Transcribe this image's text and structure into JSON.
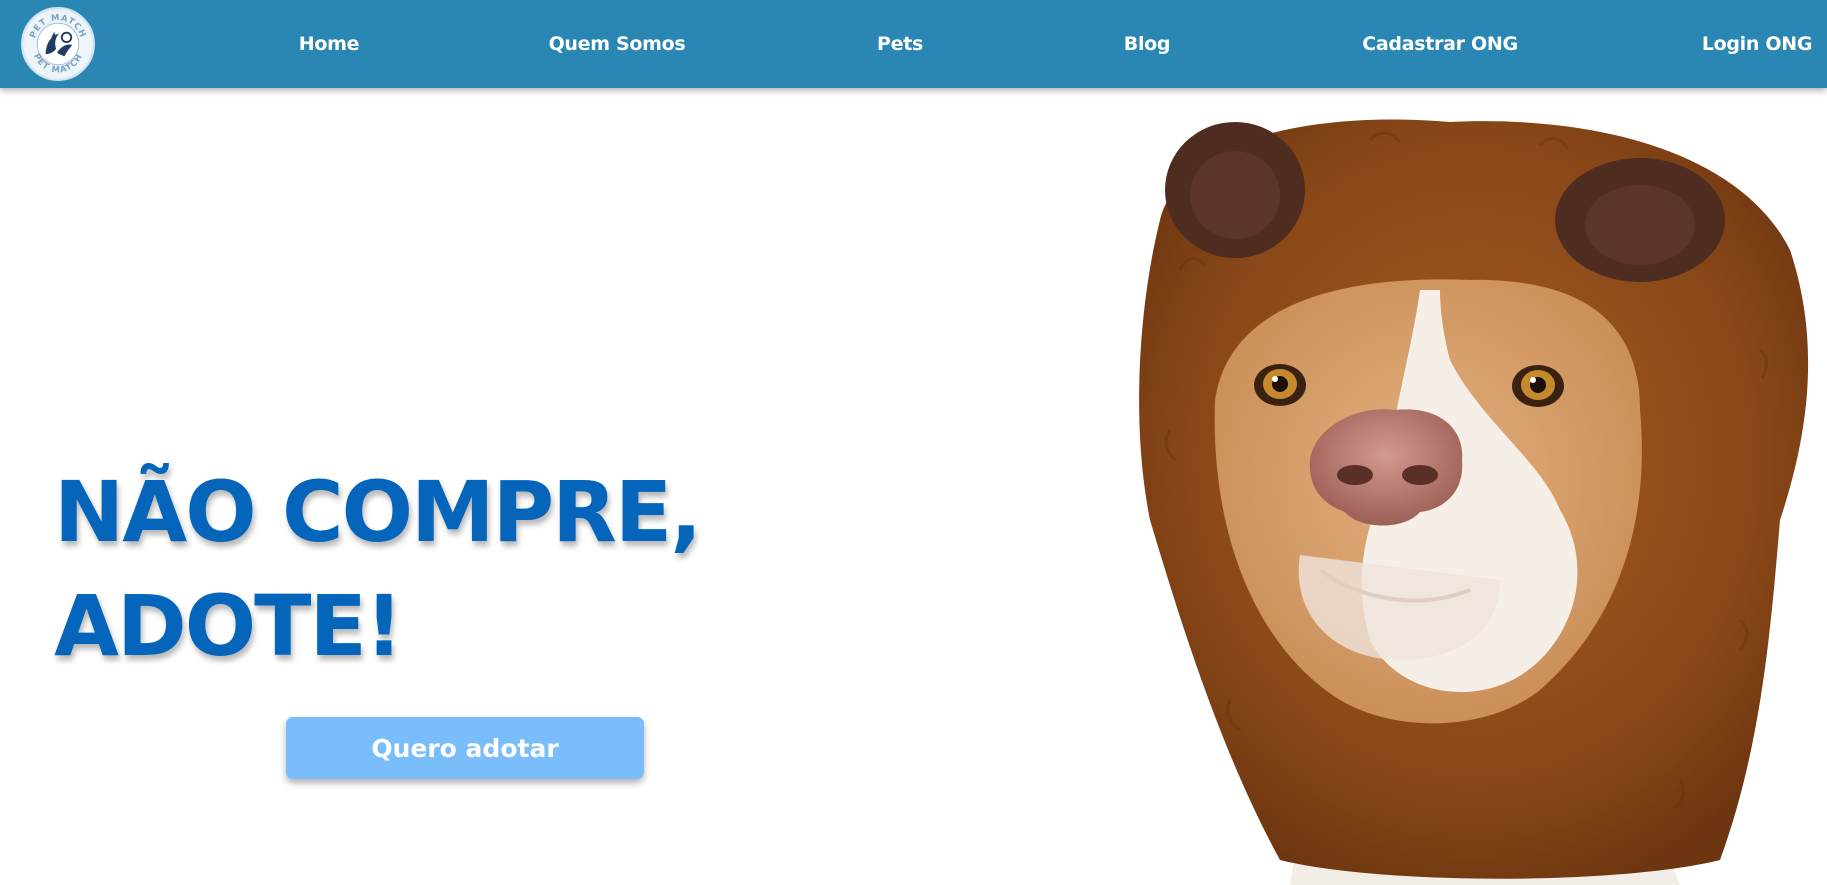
{
  "nav": {
    "logo_text": "PET MATCH",
    "items": [
      {
        "label": "Home"
      },
      {
        "label": "Quem Somos"
      },
      {
        "label": "Pets"
      },
      {
        "label": "Blog"
      },
      {
        "label": "Cadastrar ONG"
      },
      {
        "label": "Login ONG"
      }
    ]
  },
  "hero": {
    "headline_line1": "NÃO COMPRE,",
    "headline_line2": "ADOTE!",
    "cta_label": "Quero adotar",
    "image_subject": "dog-in-bear-hood-photo"
  },
  "colors": {
    "navbar": "#2a86b2",
    "headline": "#0565bb",
    "cta": "#79bdfb",
    "nav_text": "#ffffff"
  }
}
